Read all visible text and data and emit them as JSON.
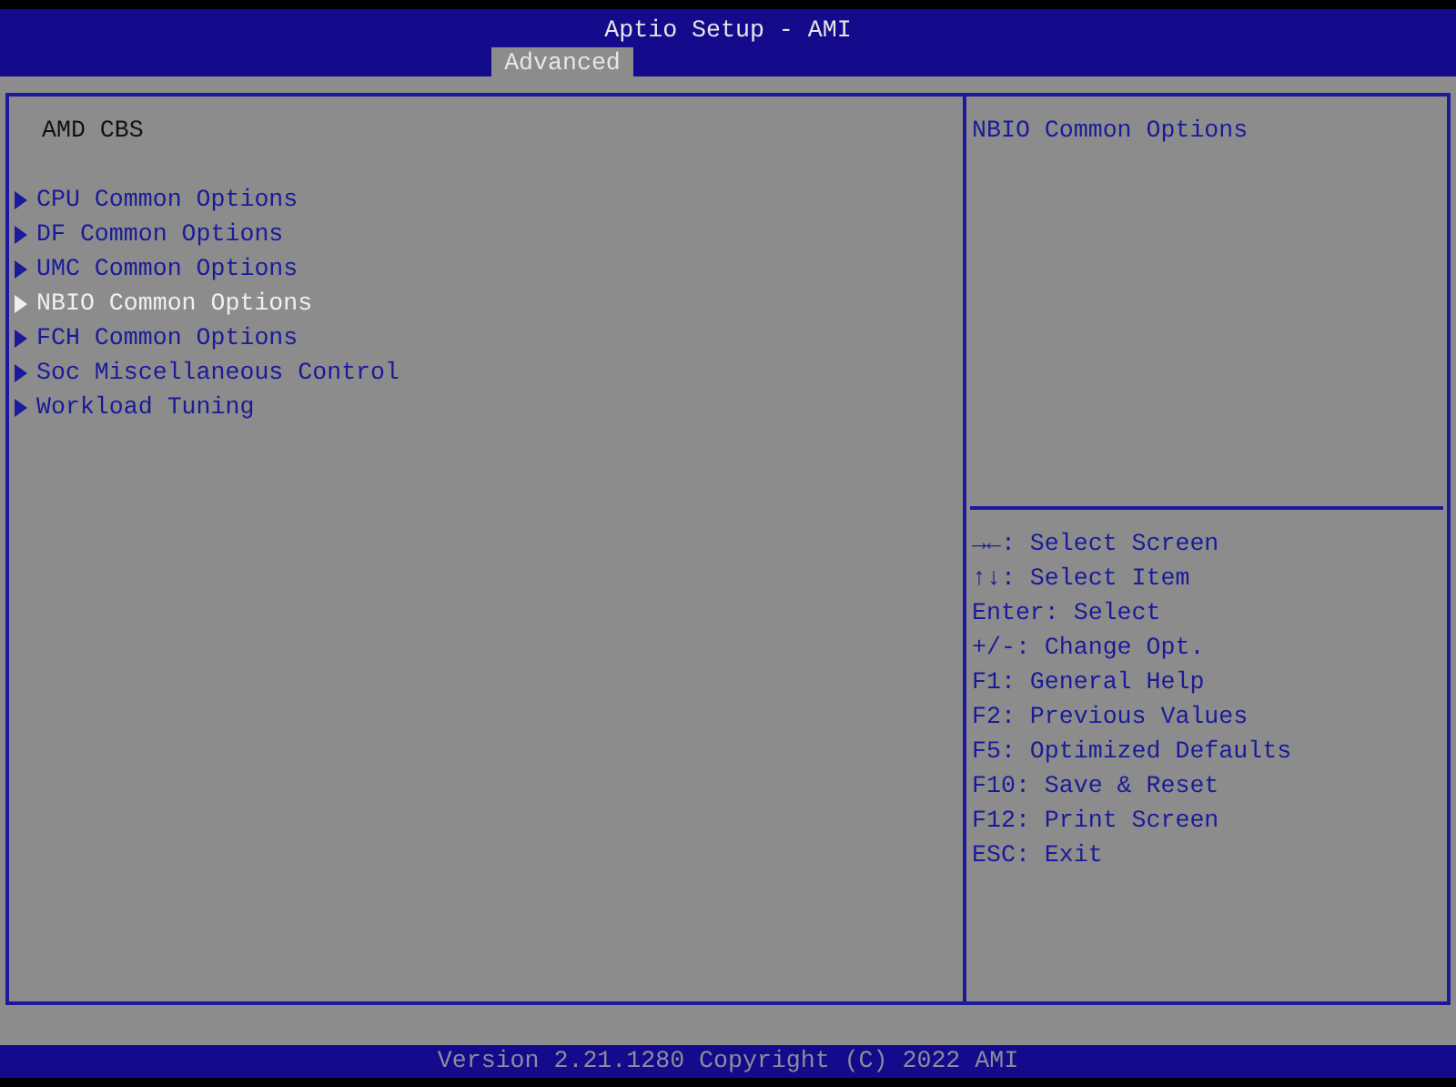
{
  "window": {
    "title": "Aptio Setup - AMI"
  },
  "tabs": [
    {
      "label": "Advanced",
      "selected": true
    }
  ],
  "page_title": "AMD CBS",
  "menu_items": [
    {
      "label": "CPU Common Options",
      "selected": false
    },
    {
      "label": "DF Common Options",
      "selected": false
    },
    {
      "label": "UMC Common Options",
      "selected": false
    },
    {
      "label": "NBIO Common Options",
      "selected": true
    },
    {
      "label": "FCH Common Options",
      "selected": false
    },
    {
      "label": "Soc Miscellaneous Control",
      "selected": false
    },
    {
      "label": "Workload Tuning",
      "selected": false
    }
  ],
  "help_text": "NBIO Common Options",
  "key_help": [
    "→←: Select Screen",
    "↑↓: Select Item",
    "Enter: Select",
    "+/-: Change Opt.",
    "F1: General Help",
    "F2: Previous Values",
    "F5: Optimized Defaults",
    "F10: Save & Reset",
    "F12: Print Screen",
    "ESC: Exit"
  ],
  "status_bar": "Version 2.21.1280 Copyright (C) 2022 AMI"
}
